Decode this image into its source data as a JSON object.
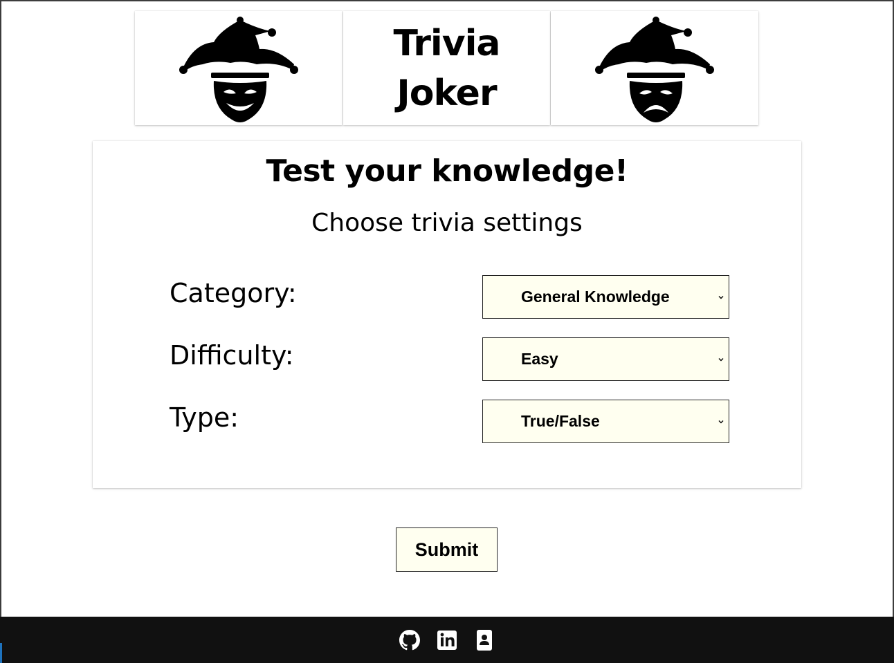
{
  "header": {
    "title_line1": "Trivia",
    "title_line2": "Joker",
    "left_icon": "jester-happy-icon",
    "right_icon": "jester-sad-icon"
  },
  "card": {
    "heading": "Test your knowledge!",
    "subheading": "Choose trivia settings",
    "fields": [
      {
        "label": "Category:",
        "value": "General Knowledge"
      },
      {
        "label": "Difficulty:",
        "value": "Easy"
      },
      {
        "label": "Type:",
        "value": "True/False"
      }
    ]
  },
  "submit_label": "Submit",
  "footer": {
    "icons": [
      "github-icon",
      "linkedin-icon",
      "contact-card-icon"
    ]
  },
  "colors": {
    "select_bg": "#fffff0",
    "footer_bg": "#111111"
  }
}
